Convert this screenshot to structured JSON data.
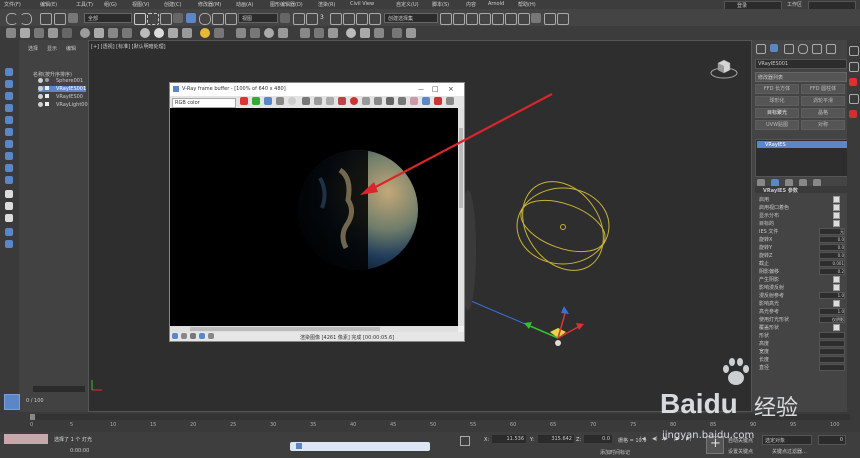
{
  "menu": {
    "items": [
      "文件(F)",
      "编辑(E)",
      "工具(T)",
      "组(G)",
      "视图(V)",
      "创建(C)",
      "修改器(M)",
      "动画(A)",
      "图形编辑器(D)",
      "渲染(R)",
      "Civil View",
      "自定义(U)",
      "脚本(S)",
      "内容",
      "Arnold",
      "帮助(H)"
    ],
    "login": "登录",
    "workspace": "工作区"
  },
  "toolbar": {
    "filter_select": "全部",
    "view_select": "视图",
    "selection_set": "创建选择集",
    "value_3": "3"
  },
  "scene_explorer": {
    "tabs": [
      "选择",
      "显示",
      "编辑"
    ],
    "header": "名称(按升序排序)",
    "items": [
      "Sphere001",
      "VRayIES001",
      "VRayIES00",
      "VRayLight00"
    ],
    "footer": "0 / 100"
  },
  "viewport": {
    "label": "[+] [透视] [标准] [默认明暗处理]"
  },
  "vfb": {
    "title": "V-Ray frame buffer - [100% of 640 x 480]",
    "channel": "RGB color",
    "status": "渲染图像 [4261 像素] 完成 [00:00:05.6]"
  },
  "command_panel": {
    "object_name": "VRayIES001",
    "modifier_list": "修改器列表",
    "buttons": [
      "FFD 长方体",
      "FFD 圆柱体",
      "球形化",
      "涡轮平滑",
      "目标聚光",
      "晶格",
      "UVW贴图",
      "对称"
    ],
    "stack_item": "VRayIES",
    "rollout_title": "VRayIES 参数",
    "params": [
      {
        "label": "启用",
        "type": "check"
      },
      {
        "label": "启用视口着色",
        "type": "check"
      },
      {
        "label": "显示分布",
        "type": "check"
      },
      {
        "label": "目标的",
        "type": "check"
      },
      {
        "label": "IES 文件",
        "type": "text",
        "value": "无"
      },
      {
        "label": "旋转X",
        "type": "spin",
        "value": "0.0"
      },
      {
        "label": "旋转Y",
        "type": "spin",
        "value": "0.0"
      },
      {
        "label": "旋转Z",
        "type": "spin",
        "value": "0.0"
      },
      {
        "label": "截止",
        "type": "spin",
        "value": "0.001"
      },
      {
        "label": "阴影偏移",
        "type": "spin",
        "value": "0.2"
      },
      {
        "label": "产生阴影",
        "type": "check"
      },
      {
        "label": "影响漫反射",
        "type": "check"
      },
      {
        "label": "漫反射参考",
        "type": "spin",
        "value": "1.0"
      },
      {
        "label": "影响高光",
        "type": "check"
      },
      {
        "label": "高光参考",
        "type": "spin",
        "value": "1.0"
      },
      {
        "label": "使用灯光形状",
        "type": "text",
        "value": "仅阴影"
      },
      {
        "label": "覆盖形状",
        "type": "check"
      },
      {
        "label": "形状",
        "type": "text",
        "value": ""
      },
      {
        "label": "高度",
        "type": "spin",
        "value": ""
      },
      {
        "label": "宽度",
        "type": "spin",
        "value": ""
      },
      {
        "label": "长度",
        "type": "spin",
        "value": ""
      },
      {
        "label": "直径",
        "type": "spin",
        "value": ""
      }
    ]
  },
  "timeline": {
    "ticks": [
      "0",
      "5",
      "10",
      "15",
      "20",
      "25",
      "30",
      "35",
      "40",
      "45",
      "50",
      "55",
      "60",
      "65",
      "70",
      "75",
      "80",
      "85",
      "90",
      "95",
      "100"
    ]
  },
  "statusbar": {
    "selection": "选择了 1 个 灯光",
    "x_value": "11.536",
    "y_value": "315.642",
    "z_value": "0.0",
    "grid": "栅格 = 10.0",
    "auto_key": "自动关键点",
    "set_key": "设置关键点",
    "key_filter": "选定对象",
    "key_filter_label": "关键点过滤器...",
    "add_time_tag": "添加时间标记",
    "frame": "0",
    "time_display": "0:00:00",
    "rt_label": "R"
  },
  "watermark": {
    "brand": "Baidu",
    "cn": "经验",
    "url": "jingyan.baidu.com"
  },
  "colors": {
    "arrow": "#d9262a",
    "light_gizmo": "#c7b23a",
    "accent_blue": "#5b86c7"
  }
}
